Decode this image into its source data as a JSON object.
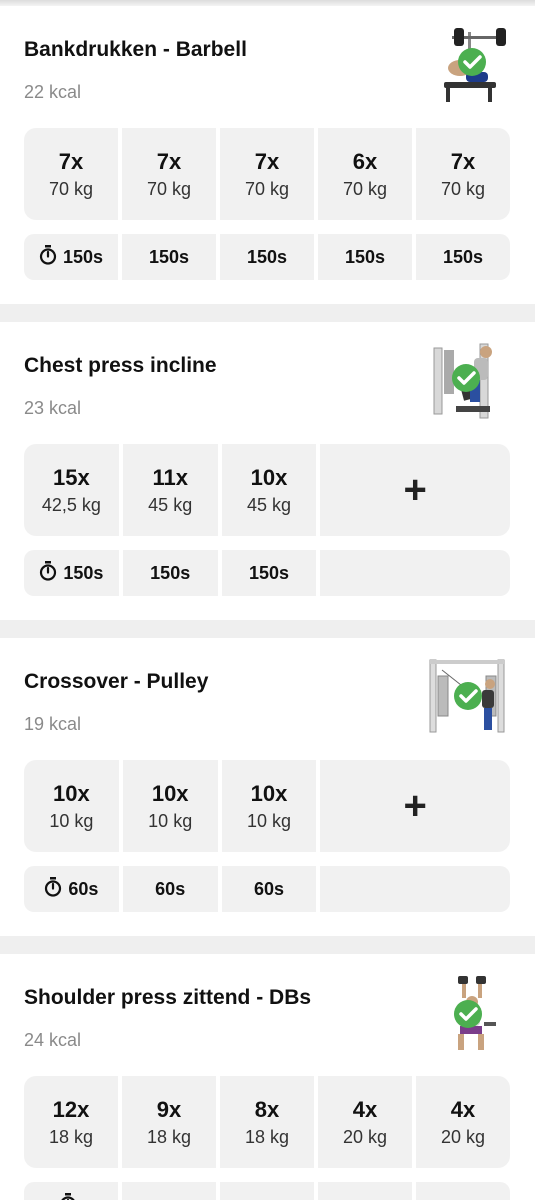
{
  "exercises": [
    {
      "name": "Bankdrukken - Barbell",
      "kcal": "22 kcal",
      "sets": [
        {
          "reps": "7x",
          "weight": "70 kg"
        },
        {
          "reps": "7x",
          "weight": "70 kg"
        },
        {
          "reps": "7x",
          "weight": "70 kg"
        },
        {
          "reps": "6x",
          "weight": "70 kg"
        },
        {
          "reps": "7x",
          "weight": "70 kg"
        }
      ],
      "rests": [
        "150s",
        "150s",
        "150s",
        "150s",
        "150s"
      ],
      "thumb_icon": "bench-press-illustration",
      "completed": true
    },
    {
      "name": "Chest press incline",
      "kcal": "23 kcal",
      "sets": [
        {
          "reps": "15x",
          "weight": "42,5 kg"
        },
        {
          "reps": "11x",
          "weight": "45 kg"
        },
        {
          "reps": "10x",
          "weight": "45 kg"
        }
      ],
      "add_label": "+",
      "rests": [
        "150s",
        "150s",
        "150s"
      ],
      "thumb_icon": "chest-press-machine-illustration",
      "completed": true
    },
    {
      "name": "Crossover - Pulley",
      "kcal": "19 kcal",
      "sets": [
        {
          "reps": "10x",
          "weight": "10 kg"
        },
        {
          "reps": "10x",
          "weight": "10 kg"
        },
        {
          "reps": "10x",
          "weight": "10 kg"
        }
      ],
      "add_label": "+",
      "rests": [
        "60s",
        "60s",
        "60s"
      ],
      "thumb_icon": "cable-crossover-illustration",
      "completed": true
    },
    {
      "name": "Shoulder press zittend - DBs",
      "kcal": "24 kcal",
      "sets": [
        {
          "reps": "12x",
          "weight": "18 kg"
        },
        {
          "reps": "9x",
          "weight": "18 kg"
        },
        {
          "reps": "8x",
          "weight": "18 kg"
        },
        {
          "reps": "4x",
          "weight": "20 kg"
        },
        {
          "reps": "4x",
          "weight": "20 kg"
        }
      ],
      "thumb_icon": "seated-dumbbell-press-illustration",
      "completed": true
    }
  ],
  "colors": {
    "check": "#4caf50",
    "cell_bg": "#f1f1f1",
    "divider": "#efefef",
    "kcal_text": "#8a8a8a"
  }
}
